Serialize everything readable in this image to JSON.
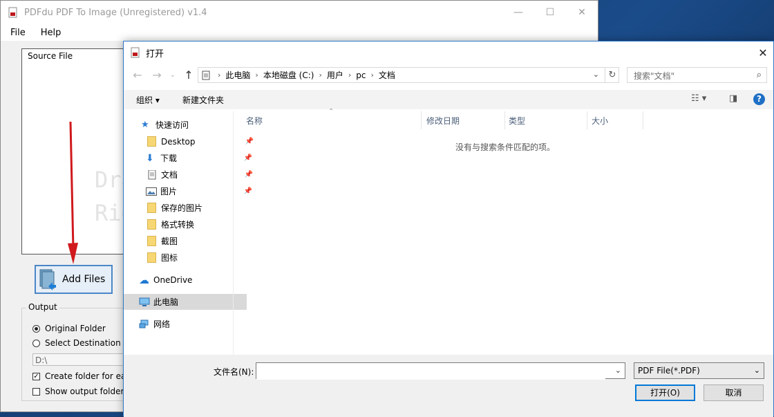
{
  "app": {
    "title": "PDFdu PDF To Image (Unregistered) v1.4",
    "menu": [
      "File",
      "Help"
    ],
    "source_label": "Source File",
    "watermark_lines": [
      "Dra",
      "Righ"
    ],
    "add_files_label": "Add Files",
    "output": {
      "legend": "Output",
      "original_folder": "Original Folder",
      "select_destination": "Select Destination Fo",
      "path": "D:\\",
      "create_folder": "Create folder for eac",
      "show_output": "Show output folder w"
    }
  },
  "dialog": {
    "title": "打开",
    "breadcrumbs": [
      "此电脑",
      "本地磁盘 (C:)",
      "用户",
      "pc",
      "文档"
    ],
    "search_placeholder": "搜索\"文档\"",
    "toolbar": {
      "organize": "组织 ▾",
      "new_folder": "新建文件夹"
    },
    "nav_items": [
      {
        "label": "快速访问",
        "icon": "star-icon"
      },
      {
        "label": "Desktop",
        "icon": "folder-icon",
        "pinned": true
      },
      {
        "label": "下载",
        "icon": "download-arrow-icon",
        "pinned": true
      },
      {
        "label": "文档",
        "icon": "document-icon",
        "pinned": true
      },
      {
        "label": "图片",
        "icon": "picture-icon",
        "pinned": true
      },
      {
        "label": "保存的图片",
        "icon": "folder-icon"
      },
      {
        "label": "格式转换",
        "icon": "folder-icon"
      },
      {
        "label": "截图",
        "icon": "folder-icon"
      },
      {
        "label": "图标",
        "icon": "folder-icon"
      },
      {
        "label": "OneDrive",
        "icon": "cloud-icon"
      },
      {
        "label": "此电脑",
        "icon": "computer-icon",
        "selected": true
      },
      {
        "label": "网络",
        "icon": "network-icon"
      }
    ],
    "columns": [
      "名称",
      "修改日期",
      "类型",
      "大小"
    ],
    "empty_message": "没有与搜索条件匹配的项。",
    "filename_label": "文件名(N):",
    "filename_value": "",
    "filetype": "PDF File(*.PDF)",
    "open_button": "打开(O)",
    "cancel_button": "取消"
  },
  "colors": {
    "accent": "#0078d7",
    "arrow": "#d0191c"
  }
}
